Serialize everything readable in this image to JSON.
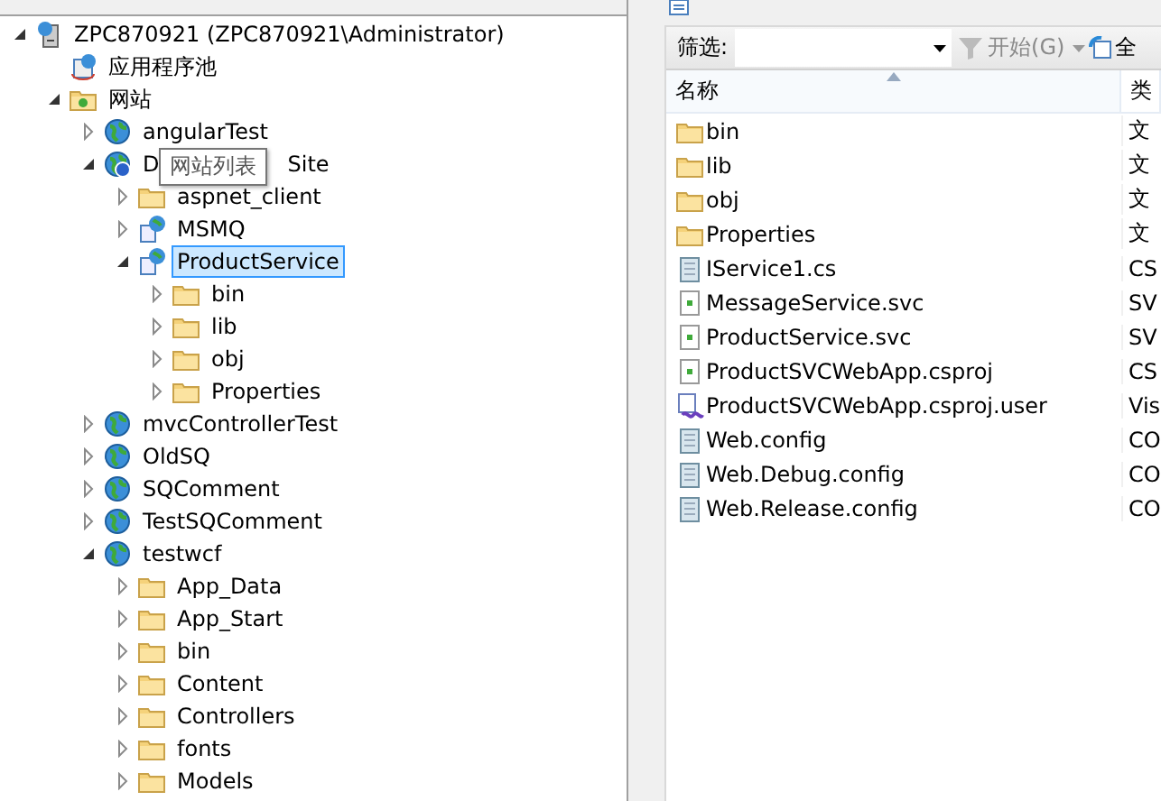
{
  "tree": [
    {
      "label": "ZPC870921 (ZPC870921\\Administrator)",
      "kind": "server",
      "expanded": true,
      "selected": false,
      "children": [
        {
          "label": "应用程序池",
          "kind": "apppool",
          "selected": false
        },
        {
          "label": "网站",
          "kind": "sites",
          "expanded": true,
          "selected": false,
          "children": [
            {
              "label": "angularTest",
              "kind": "globe",
              "expanded": false,
              "selected": false
            },
            {
              "label": "D",
              "label_tail": "Site",
              "kind": "globehelp",
              "expanded": true,
              "selected": false,
              "children": [
                {
                  "label": "aspnet_client",
                  "kind": "folder",
                  "expanded": false,
                  "selected": false
                },
                {
                  "label": "MSMQ",
                  "kind": "app",
                  "expanded": false,
                  "selected": false
                },
                {
                  "label": "ProductService",
                  "kind": "app",
                  "expanded": true,
                  "selected": true,
                  "children": [
                    {
                      "label": "bin",
                      "kind": "folder",
                      "expanded": false,
                      "selected": false
                    },
                    {
                      "label": "lib",
                      "kind": "folder",
                      "expanded": false,
                      "selected": false
                    },
                    {
                      "label": "obj",
                      "kind": "folder",
                      "expanded": false,
                      "selected": false
                    },
                    {
                      "label": "Properties",
                      "kind": "folder",
                      "expanded": false,
                      "selected": false
                    }
                  ]
                }
              ]
            },
            {
              "label": "mvcControllerTest",
              "kind": "globe",
              "expanded": false,
              "selected": false
            },
            {
              "label": "OldSQ",
              "kind": "globe",
              "expanded": false,
              "selected": false
            },
            {
              "label": "SQComment",
              "kind": "globe",
              "expanded": false,
              "selected": false
            },
            {
              "label": "TestSQComment",
              "kind": "globe",
              "expanded": false,
              "selected": false
            },
            {
              "label": "testwcf",
              "kind": "globe",
              "expanded": true,
              "selected": false,
              "children": [
                {
                  "label": "App_Data",
                  "kind": "folder",
                  "expanded": false,
                  "selected": false
                },
                {
                  "label": "App_Start",
                  "kind": "folder",
                  "expanded": false,
                  "selected": false
                },
                {
                  "label": "bin",
                  "kind": "folder",
                  "expanded": false,
                  "selected": false
                },
                {
                  "label": "Content",
                  "kind": "folder",
                  "expanded": false,
                  "selected": false
                },
                {
                  "label": "Controllers",
                  "kind": "folder",
                  "expanded": false,
                  "selected": false
                },
                {
                  "label": "fonts",
                  "kind": "folder",
                  "expanded": false,
                  "selected": false
                },
                {
                  "label": "Models",
                  "kind": "folder",
                  "expanded": false,
                  "selected": false
                }
              ]
            }
          ]
        }
      ]
    }
  ],
  "tooltip": "网站列表",
  "filter": {
    "label": "筛选:",
    "go_button": "开始(G)",
    "show_all_button": "全"
  },
  "columns": [
    {
      "label": "名称",
      "sorted": true
    },
    {
      "label": "类",
      "sorted": false
    }
  ],
  "files": [
    {
      "name": "bin",
      "kind": "folder",
      "type": "文"
    },
    {
      "name": "lib",
      "kind": "folder",
      "type": "文"
    },
    {
      "name": "obj",
      "kind": "folder",
      "type": "文"
    },
    {
      "name": "Properties",
      "kind": "folder",
      "type": "文"
    },
    {
      "name": "IService1.cs",
      "kind": "text",
      "type": "CS"
    },
    {
      "name": "MessageService.svc",
      "kind": "svc",
      "type": "SV"
    },
    {
      "name": "ProductService.svc",
      "kind": "svc",
      "type": "SV"
    },
    {
      "name": "ProductSVCWebApp.csproj",
      "kind": "svc",
      "type": "CS"
    },
    {
      "name": "ProductSVCWebApp.csproj.user",
      "kind": "vs",
      "type": "Vis"
    },
    {
      "name": "Web.config",
      "kind": "text",
      "type": "CO"
    },
    {
      "name": "Web.Debug.config",
      "kind": "text",
      "type": "CO"
    },
    {
      "name": "Web.Release.config",
      "kind": "text",
      "type": "CO"
    }
  ]
}
